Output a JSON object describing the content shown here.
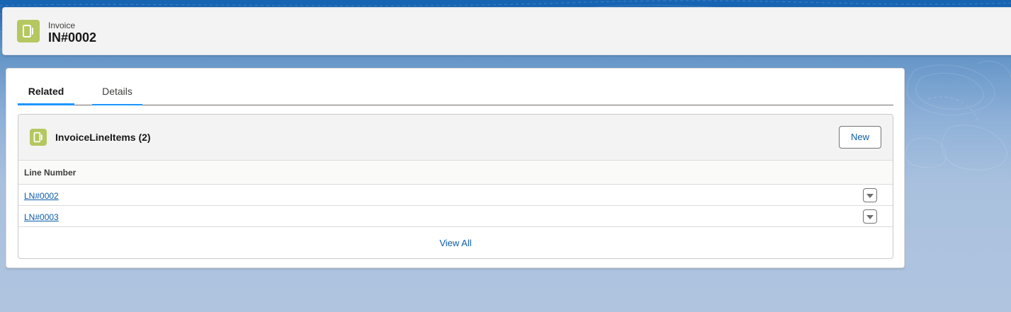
{
  "header": {
    "record_type": "Invoice",
    "record_name": "IN#0002",
    "icon": "invoice-icon",
    "icon_color": "#b4c760"
  },
  "tabs": [
    {
      "label": "Related",
      "active": true
    },
    {
      "label": "Details",
      "active": false
    }
  ],
  "related_list": {
    "title": "InvoiceLineItems (2)",
    "icon": "invoice-line-item-icon",
    "new_button_label": "New",
    "columns": [
      "Line Number"
    ],
    "rows": [
      {
        "line_number": "LN#0002"
      },
      {
        "line_number": "LN#0003"
      }
    ],
    "view_all_label": "View All"
  },
  "colors": {
    "brand_bar": "#1764b3",
    "link": "#0b5cab",
    "tab_accent": "#1b96ff"
  }
}
